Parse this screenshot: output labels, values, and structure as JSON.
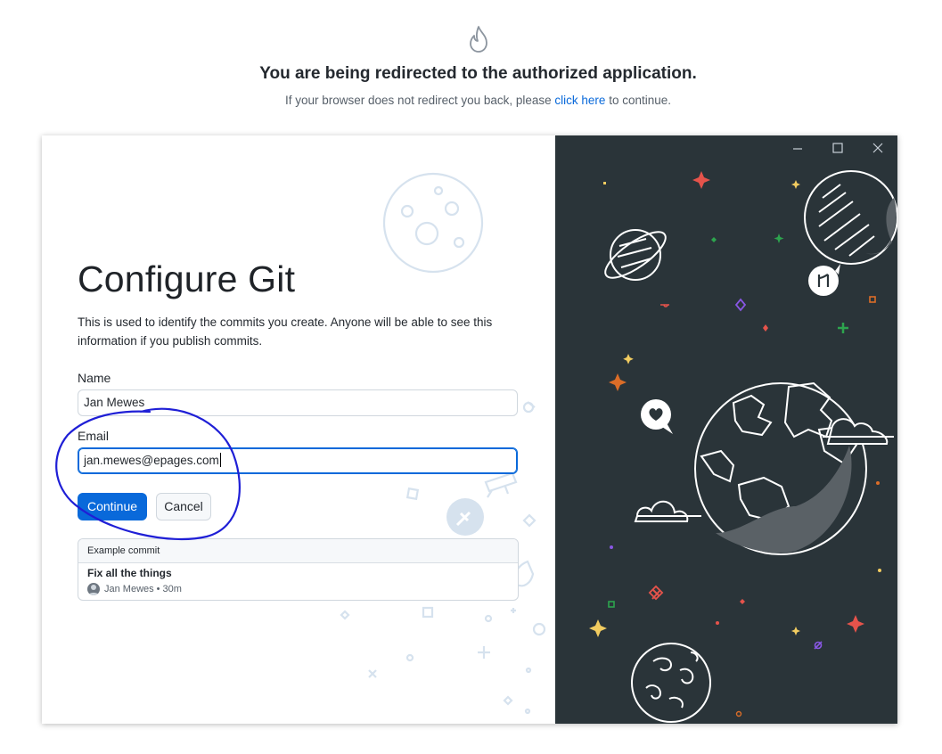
{
  "redirect": {
    "title": "You are being redirected to the authorized application.",
    "message_before": "If your browser does not redirect you back, please ",
    "link": "click here",
    "message_after": " to continue."
  },
  "dialog": {
    "heading": "Configure Git",
    "description": "This is used to identify the commits you create. Anyone will be able to see this information if you publish commits.",
    "name_label": "Name",
    "name_value": "Jan Mewes",
    "email_label": "Email",
    "email_value": "jan.mewes@epages.com",
    "continue_label": "Continue",
    "cancel_label": "Cancel"
  },
  "example_commit": {
    "header": "Example commit",
    "message": "Fix all the things",
    "author": "Jan Mewes",
    "separator": "•",
    "time": "30m"
  },
  "colors": {
    "accent": "#0969da",
    "art_background": "#2a3439",
    "annotation_ink": "#1f1fd6"
  }
}
